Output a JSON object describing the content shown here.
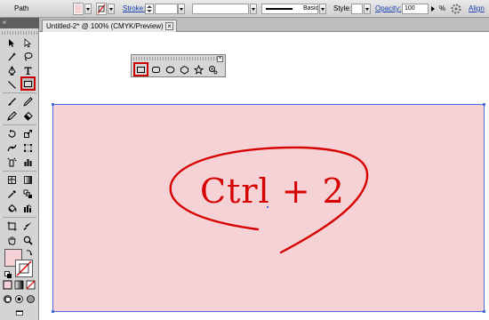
{
  "control_bar": {
    "path_label": "Path",
    "stroke_label": "Stroke:",
    "stroke_style": "Basic",
    "style_label": "Style:",
    "opacity_label": "Opacity:",
    "opacity_value": "100",
    "percent": "%",
    "align_label": "Align",
    "fill_color": "#f4d2d6",
    "link_color": "#1a3fb0"
  },
  "left_panel": {
    "collapse_glyph": "«"
  },
  "document_tab": {
    "title": "Untitled-2* @ 100% (CMYK/Preview)",
    "close_glyph": "×"
  },
  "tools": [
    "selection-tool",
    "direct-selection-tool",
    "magic-wand-tool",
    "lasso-tool",
    "pen-tool",
    "type-tool",
    "line-tool",
    "rectangle-tool",
    "paintbrush-tool",
    "pencil-tool",
    "blob-brush-tool",
    "eraser-tool",
    "rotate-tool",
    "scale-tool",
    "warp-tool",
    "free-transform-tool",
    "symbol-sprayer-tool",
    "column-graph-tool",
    "mesh-tool",
    "gradient-tool",
    "eyedropper-tool",
    "blend-tool",
    "live-paint-tool",
    "live-paint-selection-tool",
    "crop-area-tool",
    "slice-tool",
    "hand-tool",
    "zoom-tool"
  ],
  "shapes_panel": {
    "close_glyph": "×",
    "items": [
      "rectangle-tool",
      "rounded-rectangle-tool",
      "ellipse-tool",
      "polygon-tool",
      "star-tool",
      "flare-tool"
    ]
  },
  "annotation": {
    "text": "Ctrl + 2",
    "color": "#d60000"
  },
  "colors": {
    "artboard_fill": "#f4d2d6",
    "selection_blue": "#4a6bd8",
    "highlight_red": "#cc0000"
  }
}
